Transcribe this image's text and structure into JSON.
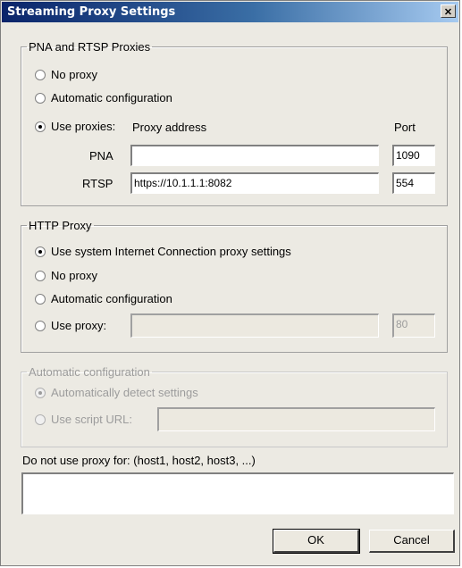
{
  "window": {
    "title": "Streaming Proxy Settings"
  },
  "pna_rtsp": {
    "legend": "PNA and RTSP Proxies",
    "no_proxy": "No proxy",
    "auto_config": "Automatic configuration",
    "use_proxies": "Use proxies:",
    "proxy_address_header": "Proxy address",
    "port_header": "Port",
    "pna_label": "PNA",
    "pna_address": "",
    "pna_port": "1090",
    "rtsp_label": "RTSP",
    "rtsp_address": "https://10.1.1.1:8082",
    "rtsp_port": "554",
    "selected": "use_proxies"
  },
  "http": {
    "legend": "HTTP Proxy",
    "use_system": "Use system Internet Connection proxy settings",
    "no_proxy": "No proxy",
    "auto_config": "Automatic configuration",
    "use_proxy": "Use proxy:",
    "proxy_address": "",
    "port": "80",
    "selected": "use_system"
  },
  "auto_config": {
    "legend": "Automatic configuration",
    "auto_detect": "Automatically detect settings",
    "use_script": "Use script URL:",
    "script_url": ""
  },
  "exclusions": {
    "label": "Do not use proxy for: (host1, host2, host3, ...)",
    "value": ""
  },
  "buttons": {
    "ok": "OK",
    "cancel": "Cancel"
  }
}
